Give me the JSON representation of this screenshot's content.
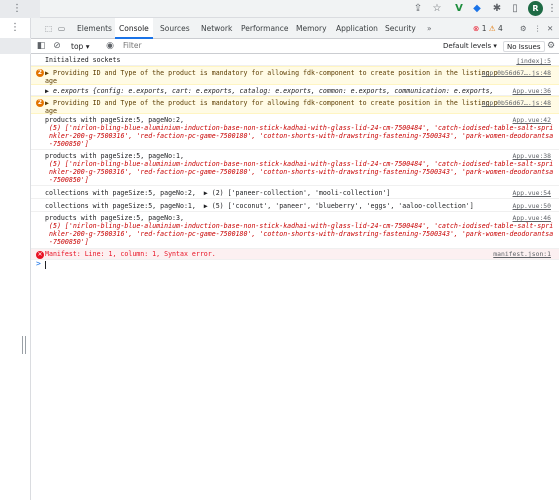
{
  "window": {
    "avatar": "R"
  },
  "tabs": [
    "Elements",
    "Console",
    "Sources",
    "Network",
    "Performance",
    "Memory",
    "Application",
    "Security"
  ],
  "tabs_more": "»",
  "issues": {
    "errors": "1",
    "warnings": "4"
  },
  "toolbar": {
    "context": "top",
    "filter_placeholder": "Filter",
    "levels": "Default levels",
    "no_issues": "No Issues"
  },
  "logs": [
    {
      "type": "log",
      "text": "Initialized sockets",
      "source": "[index]:5"
    },
    {
      "type": "warn",
      "count": "2",
      "text": "▶ Providing ID and Type of the product is mandatory for allowing fdk-component to create position in the listing page",
      "source": "app.0b56d67….js:48"
    },
    {
      "type": "log",
      "text": "▶ e.exports {config: e.exports, cart: e.exports, catalog: e.exports, common: e.exports, communication: e.exports, …}",
      "source": "App.vue:36"
    },
    {
      "type": "warn",
      "count": "2",
      "text": "▶ Providing ID and Type of the product is mandatory for allowing fdk-component to create position in the listing page",
      "source": "app.0b56d67….js:48"
    },
    {
      "type": "log",
      "text": "products with pageSize:5, pageNo:2,",
      "detail": "(5) ['nirlon-bling-blue-aluminium-induction-base-non-stick-kadhai-with-glass-lid-24-cm-7500484', 'catch-iodised-table-salt-sprinkler-200-g-7500316', 'red-faction-pc-game-7500180', 'cotton-shorts-with-drawstring-fastening-7500343', 'park-women-deodorantsa-7500850']",
      "source": "App.vue:42"
    },
    {
      "type": "log",
      "text": "products with pageSize:5, pageNo:1,",
      "detail": "(5) ['nirlon-bling-blue-aluminium-induction-base-non-stick-kadhai-with-glass-lid-24-cm-7500484', 'catch-iodised-table-salt-sprinkler-200-g-7500316', 'red-faction-pc-game-7500180', 'cotton-shorts-with-drawstring-fastening-7500343', 'park-women-deodorantsa-7500850']",
      "source": "App.vue:38"
    },
    {
      "type": "log",
      "text": "collections with pageSize:5, pageNo:2,  ▶ (2) ['paneer-collection', 'mooli-collection']",
      "source": "App.vue:54"
    },
    {
      "type": "log",
      "text": "collections with pageSize:5, pageNo:1,  ▶ (5) ['coconut', 'paneer', 'blueberry', 'eggs', 'aaloo-collection']",
      "source": "App.vue:50"
    },
    {
      "type": "log",
      "text": "products with pageSize:5, pageNo:3,",
      "detail": "(5) ['nirlon-bling-blue-aluminium-induction-base-non-stick-kadhai-with-glass-lid-24-cm-7500484', 'catch-iodised-table-salt-sprinkler-200-g-7500316', 'red-faction-pc-game-7500180', 'cotton-shorts-with-drawstring-fastening-7500343', 'park-women-deodorantsa-7500850']",
      "source": "App.vue:46"
    },
    {
      "type": "error",
      "text": "Manifest: Line: 1, column: 1, Syntax error.",
      "source": "manifest.json:1"
    }
  ],
  "prompt": ">"
}
